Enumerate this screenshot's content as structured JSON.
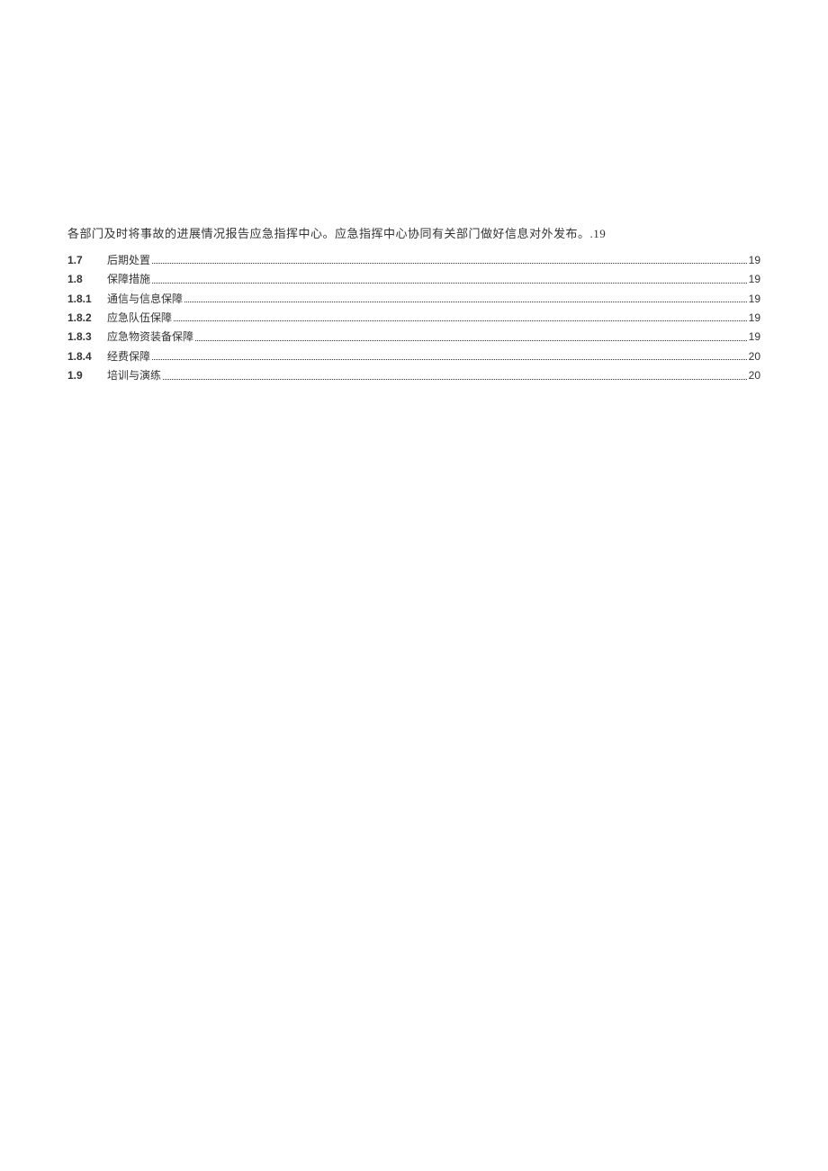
{
  "intro": "各部门及时将事故的进展情况报告应急指挥中心。应急指挥中心协同有关部门做好信息对外发布。.19",
  "toc": [
    {
      "num": "1.7",
      "title": "后期处置",
      "page": "19",
      "sub": false
    },
    {
      "num": "1.8",
      "title": "保障措施",
      "page": "19",
      "sub": false
    },
    {
      "num": "1.8.1",
      "title": "通信与信息保障",
      "page": "19",
      "sub": true
    },
    {
      "num": "1.8.2",
      "title": "应急队伍保障",
      "page": "19",
      "sub": true
    },
    {
      "num": "1.8.3",
      "title": "应急物资装备保障",
      "page": "19",
      "sub": true
    },
    {
      "num": "1.8.4",
      "title": "经费保障",
      "page": "20",
      "sub": true
    },
    {
      "num": "1.9",
      "title": "培训与演练",
      "page": "20",
      "sub": false
    }
  ]
}
